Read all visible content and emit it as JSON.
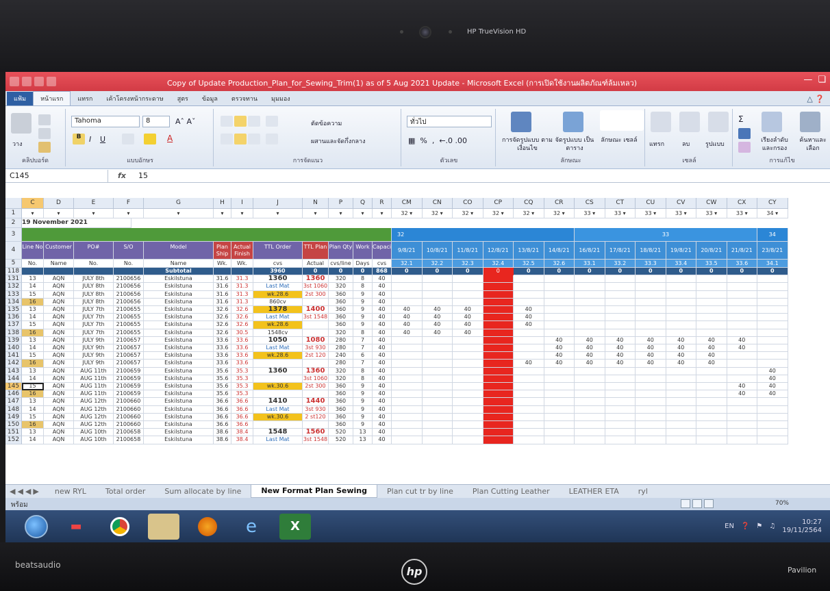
{
  "camera": {
    "label": "HP TrueVision HD"
  },
  "brand": {
    "audio": "beats",
    "audio2": "audio",
    "hp": "hp",
    "model": "Pavilion"
  },
  "window": {
    "title": "Copy of Update Production_Plan_for_Sewing_Trim(1) as of 5 Aug 2021 Update - Microsoft Excel (การเปิดใช้งานผลิตภัณฑ์ล้มเหลว)",
    "accent": "#d23b45"
  },
  "tabs": [
    "แฟ้ม",
    "หน้าแรก",
    "แทรก",
    "เค้าโครงหน้ากระดาษ",
    "สูตร",
    "ข้อมูล",
    "ตรวจทาน",
    "มุมมอง"
  ],
  "ribbon": {
    "clipboard_label": "คลิปบอร์ด",
    "paste_label": "วาง",
    "font_name": "Tahoma",
    "font_size": "8",
    "font_label": "แบบอักษร",
    "wrap_text": "ตัดข้อความ",
    "merge_center": "ผสานและจัดกึ่งกลาง",
    "alignment_label": "การจัดแนว",
    "number_format": "ทั่วไป",
    "number_label": "ตัวเลข",
    "cond_format": "การจัดรูปแบบ ตามเงื่อนไข",
    "format_table": "จัดรูปแบบ เป็นตาราง",
    "cell_styles": "ลักษณะ เซลล์",
    "styles_label": "ลักษณะ",
    "insert": "แทรก",
    "delete": "ลบ",
    "format": "รูปแบบ",
    "cells_label": "เซลล์",
    "sort_filter": "เรียงลำดับ และกรอง",
    "find_select": "ค้นหาและ เลือก",
    "editing_label": "การแก้ไข"
  },
  "formula": {
    "name_box": "C145",
    "fx": "fx",
    "value": "15"
  },
  "sheet": {
    "columns_left": [
      "C",
      "D",
      "E",
      "F",
      "G",
      "H",
      "I",
      "J",
      "N",
      "P",
      "Q",
      "R"
    ],
    "columns_right": [
      "CM",
      "CN",
      "CO",
      "CP",
      "CQ",
      "CR",
      "CS",
      "CT",
      "CU",
      "CV",
      "CW",
      "CX",
      "CY"
    ],
    "right_week_filters": [
      "32",
      "32",
      "32",
      "32",
      "32",
      "32",
      "33",
      "33",
      "33",
      "33",
      "33",
      "33",
      "34"
    ],
    "date_cell": "19 November 2021",
    "week_banner": [
      "32",
      "33",
      "34"
    ],
    "header_row": [
      "Line No",
      "Customer",
      "PO#",
      "S/O",
      "Model",
      "Plan Ship",
      "Actual Finish",
      "TTL Order",
      "TTL Plan",
      "Plan Qty",
      "Work",
      "Capacity"
    ],
    "sub_header_row": [
      "No.",
      "Name",
      "No.",
      "No.",
      "Name",
      "Wk.",
      "Wk.",
      "cvs",
      "Actual",
      "cvs/line",
      "Days",
      "cvs"
    ],
    "dates": [
      "9/8/21",
      "10/8/21",
      "11/8/21",
      "12/8/21",
      "13/8/21",
      "14/8/21",
      "16/8/21",
      "17/8/21",
      "18/8/21",
      "19/8/21",
      "20/8/21",
      "21/8/21",
      "23/8/21"
    ],
    "week_codes": [
      "32.1",
      "32.2",
      "32.3",
      "32.4",
      "32.5",
      "32.6",
      "33.1",
      "33.2",
      "33.3",
      "33.4",
      "33.5",
      "33.6",
      "34.1"
    ],
    "subtotal": {
      "row": "118",
      "label": "Subtotal",
      "ttl_order": "3960",
      "ttl_plan": "0",
      "plan_qty": "0",
      "work": "0",
      "capacity": "868",
      "right": [
        "0",
        "0",
        "0",
        "0",
        "0",
        "0",
        "0",
        "0",
        "0",
        "0",
        "0",
        "0",
        "0"
      ]
    },
    "rows": [
      {
        "r": "131",
        "c": [
          "13",
          "AQN",
          "JULY 8th",
          "2100656",
          "Eskilstuna",
          "31.6",
          "31.3",
          "1360",
          "1360",
          "320",
          "8",
          "40"
        ],
        "v": [
          "",
          "",
          "",
          "",
          "",
          "",
          "",
          "",
          "",
          "",
          "",
          "",
          ""
        ]
      },
      {
        "r": "132",
        "c": [
          "14",
          "AQN",
          "JULY 8th",
          "2100656",
          "Eskilstuna",
          "31.6",
          "31.3",
          "Last Mat",
          "3st 1060",
          "320",
          "8",
          "40"
        ],
        "v": [
          "",
          "",
          "",
          "",
          "",
          "",
          "",
          "",
          "",
          "",
          "",
          "",
          ""
        ]
      },
      {
        "r": "133",
        "c": [
          "15",
          "AQN",
          "JULY 8th",
          "2100656",
          "Eskilstuna",
          "31.6",
          "31.3",
          "wk.28.6",
          "2st 300",
          "360",
          "9",
          "40"
        ],
        "v": [
          "",
          "",
          "",
          "",
          "",
          "",
          "",
          "",
          "",
          "",
          "",
          "",
          ""
        ]
      },
      {
        "r": "134",
        "c": [
          "16",
          "AQN",
          "JULY 8th",
          "2100656",
          "Eskilstuna",
          "31.6",
          "31.3",
          "860cv",
          "",
          "360",
          "9",
          "40"
        ],
        "v": [
          "",
          "",
          "",
          "",
          "",
          "",
          "",
          "",
          "",
          "",
          "",
          "",
          ""
        ]
      },
      {
        "r": "135",
        "c": [
          "13",
          "AQN",
          "JULY 7th",
          "2100655",
          "Eskilstuna",
          "32.6",
          "32.6",
          "1378",
          "1400",
          "360",
          "9",
          "40"
        ],
        "v": [
          "40",
          "40",
          "40",
          "",
          "40",
          "",
          "",
          "",
          "",
          "",
          "",
          "",
          ""
        ]
      },
      {
        "r": "136",
        "c": [
          "14",
          "AQN",
          "JULY 7th",
          "2100655",
          "Eskilstuna",
          "32.6",
          "32.6",
          "Last Mat",
          "3st 1548",
          "360",
          "9",
          "40"
        ],
        "v": [
          "40",
          "40",
          "40",
          "",
          "40",
          "",
          "",
          "",
          "",
          "",
          "",
          "",
          ""
        ]
      },
      {
        "r": "137",
        "c": [
          "15",
          "AQN",
          "JULY 7th",
          "2100655",
          "Eskilstuna",
          "32.6",
          "32.6",
          "wk.28.6",
          "",
          "360",
          "9",
          "40"
        ],
        "v": [
          "40",
          "40",
          "40",
          "",
          "40",
          "",
          "",
          "",
          "",
          "",
          "",
          "",
          ""
        ]
      },
      {
        "r": "138",
        "c": [
          "16",
          "AQN",
          "JULY 7th",
          "2100655",
          "Eskilstuna",
          "32.6",
          "30.5",
          "1548cv",
          "",
          "320",
          "8",
          "40"
        ],
        "v": [
          "40",
          "40",
          "40",
          "",
          "",
          "",
          "",
          "",
          "",
          "",
          "",
          "",
          ""
        ]
      },
      {
        "r": "139",
        "c": [
          "13",
          "AQN",
          "JULY 9th",
          "2100657",
          "Eskilstuna",
          "33.6",
          "33.6",
          "1050",
          "1080",
          "280",
          "7",
          "40"
        ],
        "v": [
          "",
          "",
          "",
          "",
          "",
          "40",
          "40",
          "40",
          "40",
          "40",
          "40",
          "40",
          ""
        ]
      },
      {
        "r": "140",
        "c": [
          "14",
          "AQN",
          "JULY 9th",
          "2100657",
          "Eskilstuna",
          "33.6",
          "33.6",
          "Last Mat",
          "3st 930",
          "280",
          "7",
          "40"
        ],
        "v": [
          "",
          "",
          "",
          "",
          "",
          "40",
          "40",
          "40",
          "40",
          "40",
          "40",
          "40",
          ""
        ]
      },
      {
        "r": "141",
        "c": [
          "15",
          "AQN",
          "JULY 9th",
          "2100657",
          "Eskilstuna",
          "33.6",
          "33.6",
          "wk.28.6",
          "2st 120",
          "240",
          "6",
          "40"
        ],
        "v": [
          "",
          "",
          "",
          "",
          "",
          "40",
          "40",
          "40",
          "40",
          "40",
          "40",
          "",
          ""
        ]
      },
      {
        "r": "142",
        "c": [
          "16",
          "AQN",
          "JULY 9th",
          "2100657",
          "Eskilstuna",
          "33.6",
          "33.6",
          "",
          "",
          "280",
          "7",
          "40"
        ],
        "v": [
          "",
          "",
          "",
          "",
          "40",
          "40",
          "40",
          "40",
          "40",
          "40",
          "40",
          "",
          ""
        ]
      },
      {
        "r": "143",
        "c": [
          "13",
          "AQN",
          "AUG 11th",
          "2100659",
          "Eskilstuna",
          "35.6",
          "35.3",
          "1360",
          "1360",
          "320",
          "8",
          "40"
        ],
        "v": [
          "",
          "",
          "",
          "",
          "",
          "",
          "",
          "",
          "",
          "",
          "",
          "",
          "40"
        ]
      },
      {
        "r": "144",
        "c": [
          "14",
          "AQN",
          "AUG 11th",
          "2100659",
          "Eskilstuna",
          "35.6",
          "35.3",
          "",
          "3st 1060",
          "320",
          "8",
          "40"
        ],
        "v": [
          "",
          "",
          "",
          "",
          "",
          "",
          "",
          "",
          "",
          "",
          "",
          "",
          "40"
        ]
      },
      {
        "r": "145",
        "c": [
          "15",
          "AQN",
          "AUG 11th",
          "2100659",
          "Eskilstuna",
          "35.6",
          "35.3",
          "wk.30.6",
          "2st 300",
          "360",
          "9",
          "40"
        ],
        "v": [
          "",
          "",
          "",
          "",
          "",
          "",
          "",
          "",
          "",
          "",
          "",
          "40",
          "40"
        ]
      },
      {
        "r": "146",
        "c": [
          "16",
          "AQN",
          "AUG 11th",
          "2100659",
          "Eskilstuna",
          "35.6",
          "35.3",
          "",
          "",
          "360",
          "9",
          "40"
        ],
        "v": [
          "",
          "",
          "",
          "",
          "",
          "",
          "",
          "",
          "",
          "",
          "",
          "40",
          "40"
        ]
      },
      {
        "r": "147",
        "c": [
          "13",
          "AQN",
          "AUG 12th",
          "2100660",
          "Eskilstuna",
          "36.6",
          "36.6",
          "1410",
          "1440",
          "360",
          "9",
          "40"
        ],
        "v": [
          "",
          "",
          "",
          "",
          "",
          "",
          "",
          "",
          "",
          "",
          "",
          "",
          ""
        ]
      },
      {
        "r": "148",
        "c": [
          "14",
          "AQN",
          "AUG 12th",
          "2100660",
          "Eskilstuna",
          "36.6",
          "36.6",
          "Last Mat",
          "3st 930",
          "360",
          "9",
          "40"
        ],
        "v": [
          "",
          "",
          "",
          "",
          "",
          "",
          "",
          "",
          "",
          "",
          "",
          "",
          ""
        ]
      },
      {
        "r": "149",
        "c": [
          "15",
          "AQN",
          "AUG 12th",
          "2100660",
          "Eskilstuna",
          "36.6",
          "36.6",
          "wk.30.6",
          "2 st120",
          "360",
          "9",
          "40"
        ],
        "v": [
          "",
          "",
          "",
          "",
          "",
          "",
          "",
          "",
          "",
          "",
          "",
          "",
          ""
        ]
      },
      {
        "r": "150",
        "c": [
          "16",
          "AQN",
          "AUG 12th",
          "2100660",
          "Eskilstuna",
          "36.6",
          "36.6",
          "",
          "",
          "360",
          "9",
          "40"
        ],
        "v": [
          "",
          "",
          "",
          "",
          "",
          "",
          "",
          "",
          "",
          "",
          "",
          "",
          ""
        ]
      },
      {
        "r": "151",
        "c": [
          "13",
          "AQN",
          "AUG 10th",
          "2100658",
          "Eskilstuna",
          "38.6",
          "38.4",
          "1548",
          "1560",
          "520",
          "13",
          "40"
        ],
        "v": [
          "",
          "",
          "",
          "",
          "",
          "",
          "",
          "",
          "",
          "",
          "",
          "",
          ""
        ]
      },
      {
        "r": "152",
        "c": [
          "14",
          "AQN",
          "AUG 10th",
          "2100658",
          "Eskilstuna",
          "38.6",
          "38.4",
          "Last Mat",
          "3st 1548",
          "520",
          "13",
          "40"
        ],
        "v": [
          "",
          "",
          "",
          "",
          "",
          "",
          "",
          "",
          "",
          "",
          "",
          "",
          ""
        ]
      }
    ],
    "highlight_color": "#e8261f",
    "yellow": "#f3c21c",
    "line16_color": "#e8c46a"
  },
  "sheet_tabs": [
    "new RYL",
    "Total order",
    "Sum allocate by line",
    "New Format Plan Sewing",
    "Plan cut tr by line",
    "Plan Cutting Leather",
    "LEATHER ETA",
    "ryl"
  ],
  "active_sheet": "New Format Plan Sewing",
  "status": {
    "ready": "พร้อม",
    "zoom": "70%"
  },
  "taskbar": {
    "apps": [
      "media-player-icon",
      "chrome-icon",
      "folder-icon",
      "firefox-icon",
      "ie-icon",
      "excel-icon"
    ],
    "lang": "EN",
    "time": "10:27",
    "date": "19/11/2564"
  }
}
